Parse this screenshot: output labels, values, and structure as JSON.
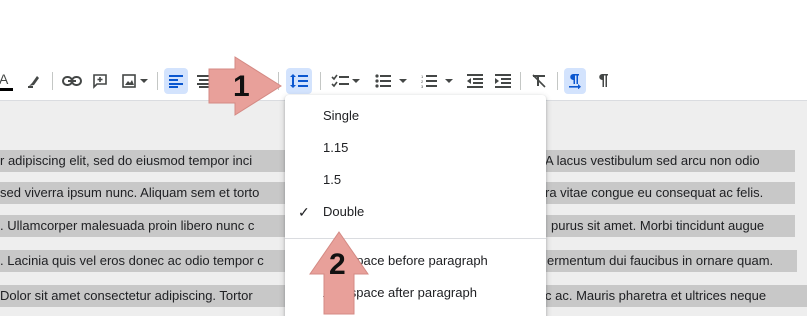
{
  "toolbar": {
    "items": [
      "text-color-icon",
      "highlight-icon",
      "link-icon",
      "comment-icon",
      "image-icon",
      "align-left-icon",
      "align-center-icon",
      "line-spacing-icon",
      "checklist-icon",
      "bulleted-list-icon",
      "numbered-list-icon",
      "decrease-indent-icon",
      "increase-indent-icon",
      "clear-formatting-icon",
      "ltr-icon",
      "rtl-icon"
    ]
  },
  "menu": {
    "items": [
      {
        "label": "Single",
        "checked": false
      },
      {
        "label": "1.15",
        "checked": false
      },
      {
        "label": "1.5",
        "checked": false
      },
      {
        "label": "Double",
        "checked": true
      },
      {
        "label": "Add space before paragraph",
        "checked": false
      },
      {
        "label": "Add space after paragraph",
        "checked": false
      }
    ],
    "check_glyph": "✓"
  },
  "document": {
    "lines": [
      {
        "left": "r adipiscing elit, sed do eiusmod tempor inci",
        "right": "A lacus vestibulum sed arcu non odio"
      },
      {
        "left": "sed viverra ipsum nunc. Aliquam sem et torto",
        "right": "ra vitae congue eu consequat ac felis."
      },
      {
        "left": ". Ullamcorper malesuada proin libero nunc c",
        "right": "purus sit amet. Morbi tincidunt augue"
      },
      {
        "left": ". Lacinia quis vel eros donec ac odio tempor c",
        "right": "ermentum dui faucibus in ornare quam."
      },
      {
        "left": "Dolor sit amet consectetur adipiscing. Tortor",
        "right": "c ac. Mauris pharetra et ultrices neque"
      }
    ]
  },
  "callouts": {
    "one": "1",
    "two": "2",
    "arrow_color": "#e8a09a"
  }
}
